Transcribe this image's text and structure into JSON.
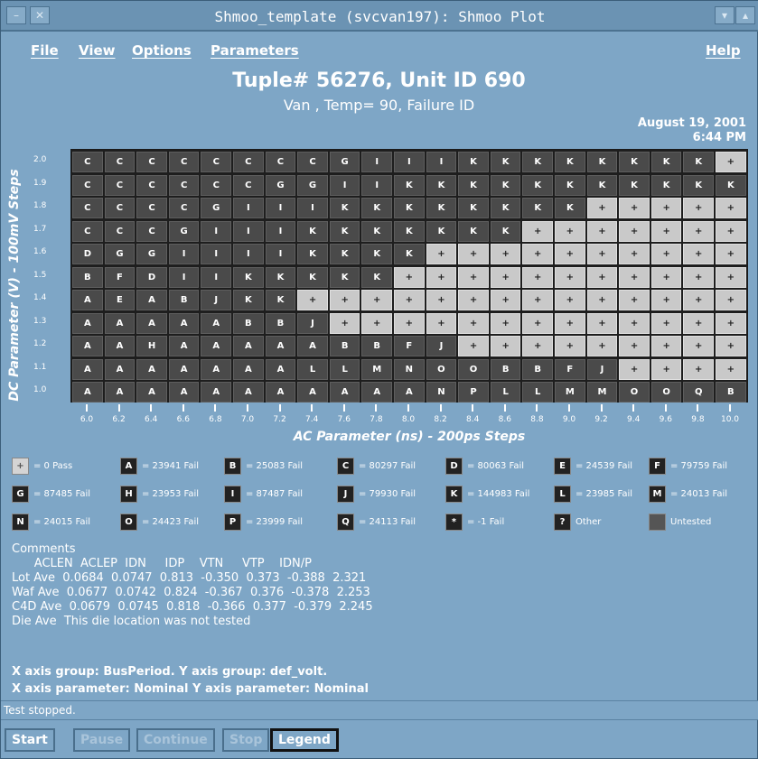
{
  "window": {
    "title": "Shmoo_template (svcvan197): Shmoo Plot"
  },
  "menu": {
    "file": "File",
    "view": "View",
    "options": "Options",
    "parameters": "Parameters",
    "help": "Help"
  },
  "header": {
    "title": "Tuple# 56276, Unit ID 690",
    "subtitle": "Van , Temp= 90, Failure ID",
    "date": "August 19, 2001",
    "time": "6:44 PM"
  },
  "plot": {
    "ylabel": "DC Parameter (V) - 100mV Steps",
    "xlabel": "AC Parameter (ns) - 200ps Steps",
    "y_ticks": [
      "2.0",
      "1.9",
      "1.8",
      "1.7",
      "1.6",
      "1.5",
      "1.4",
      "1.3",
      "1.2",
      "1.1",
      "1.0"
    ],
    "x_ticks": [
      "6.0",
      "6.2",
      "6.4",
      "6.6",
      "6.8",
      "7.0",
      "7.2",
      "7.4",
      "7.6",
      "7.8",
      "8.0",
      "8.2",
      "8.4",
      "8.6",
      "8.8",
      "9.0",
      "9.2",
      "9.4",
      "9.6",
      "9.8",
      "10.0"
    ],
    "grid": [
      [
        "C",
        "C",
        "C",
        "C",
        "C",
        "C",
        "C",
        "C",
        "G",
        "I",
        "I",
        "I",
        "K",
        "K",
        "K",
        "K",
        "K",
        "K",
        "K",
        "K",
        "+"
      ],
      [
        "C",
        "C",
        "C",
        "C",
        "C",
        "C",
        "G",
        "G",
        "I",
        "I",
        "K",
        "K",
        "K",
        "K",
        "K",
        "K",
        "K",
        "K",
        "K",
        "K",
        "K"
      ],
      [
        "C",
        "C",
        "C",
        "C",
        "G",
        "I",
        "I",
        "I",
        "K",
        "K",
        "K",
        "K",
        "K",
        "K",
        "K",
        "K",
        "+",
        "+",
        "+",
        "+",
        "+"
      ],
      [
        "C",
        "C",
        "C",
        "G",
        "I",
        "I",
        "I",
        "K",
        "K",
        "K",
        "K",
        "K",
        "K",
        "K",
        "+",
        "+",
        "+",
        "+",
        "+",
        "+",
        "+"
      ],
      [
        "D",
        "G",
        "G",
        "I",
        "I",
        "I",
        "I",
        "K",
        "K",
        "K",
        "K",
        "+",
        "+",
        "+",
        "+",
        "+",
        "+",
        "+",
        "+",
        "+",
        "+"
      ],
      [
        "B",
        "F",
        "D",
        "I",
        "I",
        "K",
        "K",
        "K",
        "K",
        "K",
        "+",
        "+",
        "+",
        "+",
        "+",
        "+",
        "+",
        "+",
        "+",
        "+",
        "+"
      ],
      [
        "A",
        "E",
        "A",
        "B",
        "J",
        "K",
        "K",
        "+",
        "+",
        "+",
        "+",
        "+",
        "+",
        "+",
        "+",
        "+",
        "+",
        "+",
        "+",
        "+",
        "+"
      ],
      [
        "A",
        "A",
        "A",
        "A",
        "A",
        "B",
        "B",
        "J",
        "+",
        "+",
        "+",
        "+",
        "+",
        "+",
        "+",
        "+",
        "+",
        "+",
        "+",
        "+",
        "+"
      ],
      [
        "A",
        "A",
        "H",
        "A",
        "A",
        "A",
        "A",
        "A",
        "B",
        "B",
        "F",
        "J",
        "+",
        "+",
        "+",
        "+",
        "+",
        "+",
        "+",
        "+",
        "+"
      ],
      [
        "A",
        "A",
        "A",
        "A",
        "A",
        "A",
        "A",
        "L",
        "L",
        "M",
        "N",
        "O",
        "O",
        "B",
        "B",
        "F",
        "J",
        "+",
        "+",
        "+",
        "+"
      ],
      [
        "A",
        "A",
        "A",
        "A",
        "A",
        "A",
        "A",
        "A",
        "A",
        "A",
        "A",
        "N",
        "P",
        "L",
        "L",
        "M",
        "M",
        "O",
        "O",
        "Q",
        "B"
      ]
    ]
  },
  "legend": {
    "rows": [
      [
        {
          "sym": "+",
          "text": "= 0 Pass",
          "pass": true
        },
        {
          "sym": "A",
          "text": "= 23941 Fail"
        },
        {
          "sym": "B",
          "text": "= 25083 Fail"
        },
        {
          "sym": "C",
          "text": "= 80297 Fail"
        },
        {
          "sym": "D",
          "text": "= 80063 Fail"
        },
        {
          "sym": "E",
          "text": "= 24539 Fail"
        },
        {
          "sym": "F",
          "text": "= 79759 Fail"
        }
      ],
      [
        {
          "sym": "G",
          "text": "= 87485 Fail"
        },
        {
          "sym": "H",
          "text": "= 23953 Fail"
        },
        {
          "sym": "I",
          "text": "= 87487 Fail"
        },
        {
          "sym": "J",
          "text": "= 79930 Fail"
        },
        {
          "sym": "K",
          "text": "= 144983 Fail"
        },
        {
          "sym": "L",
          "text": "= 23985 Fail"
        },
        {
          "sym": "M",
          "text": "= 24013 Fail"
        }
      ],
      [
        {
          "sym": "N",
          "text": "= 24015 Fail"
        },
        {
          "sym": "O",
          "text": "= 24423 Fail"
        },
        {
          "sym": "P",
          "text": "= 23999 Fail"
        },
        {
          "sym": "Q",
          "text": "= 24113 Fail"
        },
        {
          "sym": "*",
          "text": "= -1 Fail"
        },
        {
          "sym": "?",
          "text": "Other"
        },
        {
          "sym": "",
          "text": "Untested",
          "gray": true
        }
      ]
    ]
  },
  "comments": {
    "label": "Comments",
    "header": "      ACLEN  ACLEP  IDN     IDP    VTN     VTP    IDN/P",
    "lines": [
      "Lot Ave  0.0684  0.0747  0.813  -0.350  0.373  -0.388  2.321",
      "Waf Ave  0.0677  0.0742  0.824  -0.367  0.376  -0.378  2.253",
      "C4D Ave  0.0679  0.0745  0.818  -0.366  0.377  -0.379  2.245",
      "Die Ave  This die location was not tested"
    ]
  },
  "axis_info": {
    "line1": "X axis group: BusPeriod.  Y axis group: def_volt.",
    "line2": "X axis parameter: Nominal  Y axis parameter: Nominal"
  },
  "status": "Test stopped.",
  "buttons": {
    "start": "Start",
    "pause": "Pause",
    "continue": "Continue",
    "stop": "Stop",
    "legend": "Legend"
  }
}
